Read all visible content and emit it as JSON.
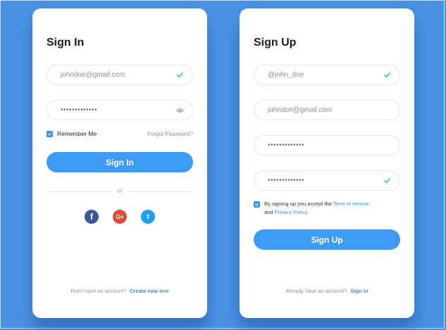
{
  "signin": {
    "title": "Sign In",
    "email_value": "johndoe@gmail.com",
    "password_value": "•••••••••••••",
    "remember_label": "Remember Me",
    "forgot_label": "Forgot Password?",
    "button_label": "Sign In",
    "divider_label": "or",
    "social": {
      "facebook": "f",
      "google": "G+",
      "twitter": "t"
    },
    "footer_text": "Don't have an account?",
    "footer_link": "Create new one"
  },
  "signup": {
    "title": "Sign Up",
    "username_value": "@john_doe",
    "email_value": "johndoe@gmail.com",
    "password_value": "•••••••••••••",
    "confirm_value": "•••••••••••••",
    "terms_text": "By signing up you accept the",
    "terms_link": "Term of service",
    "and_text": "and",
    "privacy_link": "Privacy Policy",
    "button_label": "Sign Up",
    "footer_text": "Already have an account?",
    "footer_link": "Sign In"
  },
  "icons": {
    "valid": "check-icon",
    "reveal": "eye-icon",
    "checkbox": "checkbox-icon"
  },
  "colors": {
    "background": "#4a92e4",
    "accent": "#3d9bf6",
    "check": "#2ecc71",
    "facebook": "#3b5998",
    "google": "#dd4b39",
    "twitter": "#1da1f2"
  }
}
